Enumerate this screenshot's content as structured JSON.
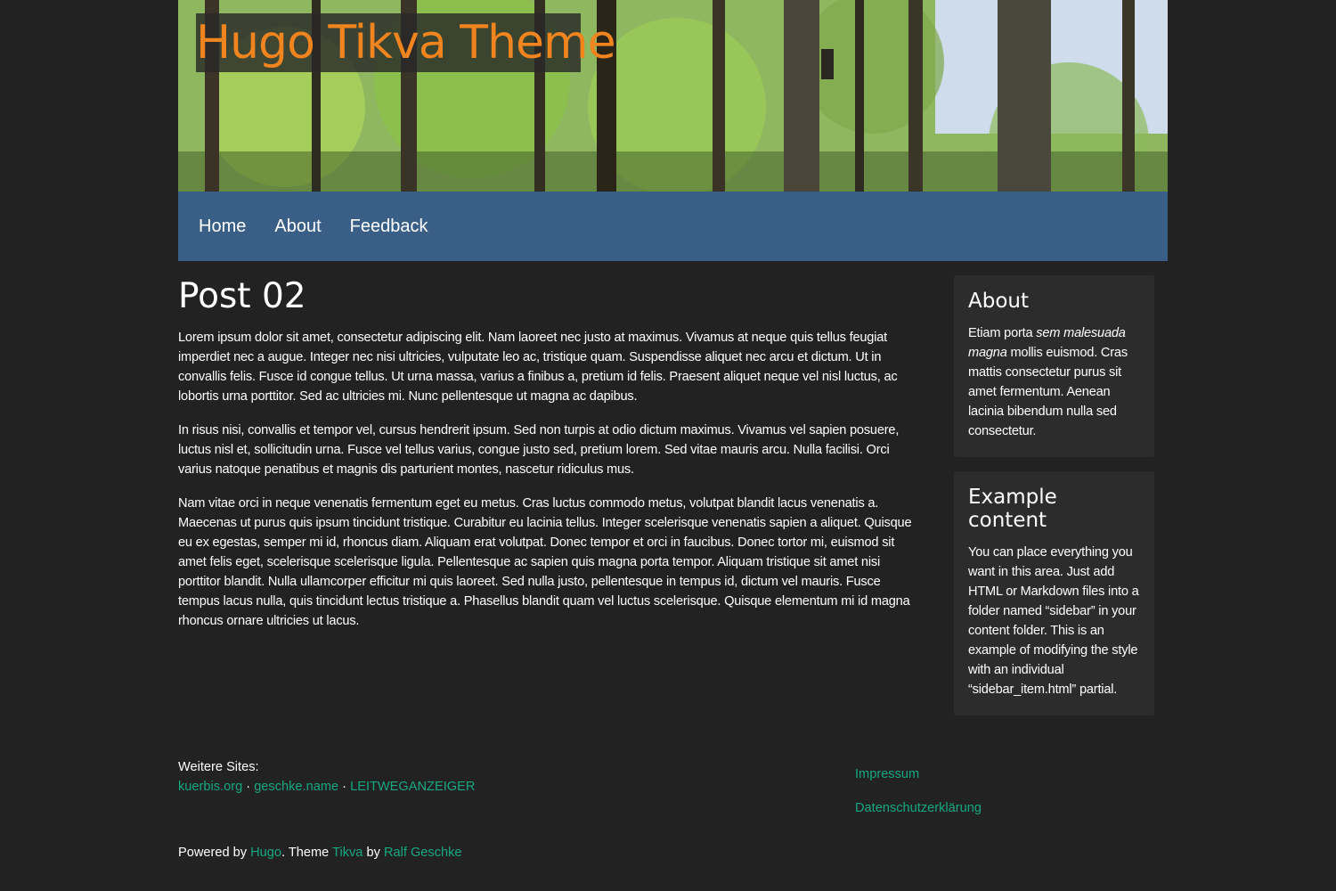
{
  "header": {
    "title": "Hugo Tikva Theme"
  },
  "nav": {
    "items": [
      "Home",
      "About",
      "Feedback"
    ]
  },
  "post": {
    "title": "Post 02",
    "paragraphs": [
      "Lorem ipsum dolor sit amet, consectetur adipiscing elit. Nam laoreet nec justo at maximus. Vivamus at neque quis tellus feugiat imperdiet nec a augue. Integer nec nisi ultricies, vulputate leo ac, tristique quam. Suspendisse aliquet nec arcu et dictum. Ut in convallis felis. Fusce id congue tellus. Ut urna massa, varius a finibus a, pretium id felis. Praesent aliquet neque vel nisl luctus, ac lobortis urna porttitor. Sed ac ultricies mi. Nunc pellentesque ut magna ac dapibus.",
      "In risus nisi, convallis et tempor vel, cursus hendrerit ipsum. Sed non turpis at odio dictum maximus. Vivamus vel sapien posuere, luctus nisl et, sollicitudin urna. Fusce vel tellus varius, congue justo sed, pretium lorem. Sed vitae mauris arcu. Nulla facilisi. Orci varius natoque penatibus et magnis dis parturient montes, nascetur ridiculus mus.",
      "Nam vitae orci in neque venenatis fermentum eget eu metus. Cras luctus commodo metus, volutpat blandit lacus venenatis a. Maecenas ut purus quis ipsum tincidunt tristique. Curabitur eu lacinia tellus. Integer scelerisque venenatis sapien a aliquet. Quisque eu ex egestas, semper mi id, rhoncus diam. Aliquam erat volutpat. Donec tempor et orci in faucibus. Donec tortor mi, euismod sit amet felis eget, scelerisque scelerisque ligula. Pellentesque ac sapien quis magna porta tempor. Aliquam tristique sit amet nisi porttitor blandit. Nulla ullamcorper efficitur mi quis laoreet. Sed nulla justo, pellentesque in tempus id, dictum vel mauris. Fusce tempus lacus nulla, quis tincidunt lectus tristique a. Phasellus blandit quam vel luctus scelerisque. Quisque elementum mi id magna rhoncus ornare ultricies ut lacus."
    ]
  },
  "sidebar": {
    "about": {
      "title": "About",
      "text_before": "Etiam porta ",
      "text_italic": "sem malesuada magna",
      "text_after": " mollis euismod. Cras mattis consectetur purus sit amet fermentum. Aenean lacinia bibendum nulla sed consectetur."
    },
    "example": {
      "title": "Example content",
      "text": "You can place everything you want in this area. Just add HTML or Markdown files into a folder named “sidebar” in your content folder. This is an example of modifying the style with an individual “sidebar_item.html” partial."
    }
  },
  "footer": {
    "other_sites_label": "Weitere Sites:",
    "sites": [
      "kuerbis.org",
      "geschke.name",
      "LEITWEGANZEIGER"
    ],
    "separator": " · ",
    "impressum": "Impressum",
    "privacy": "Datenschutzerklärung",
    "powered_prefix": "Powered by ",
    "hugo": "Hugo",
    "theme_prefix": ". Theme ",
    "tikva": "Tikva",
    "by": " by ",
    "author": "Ralf Geschke"
  },
  "colors": {
    "background": "#222222",
    "nav": "#3a5f87",
    "title": "#f0841e",
    "link": "#15a881",
    "card": "#2c2c2c"
  }
}
